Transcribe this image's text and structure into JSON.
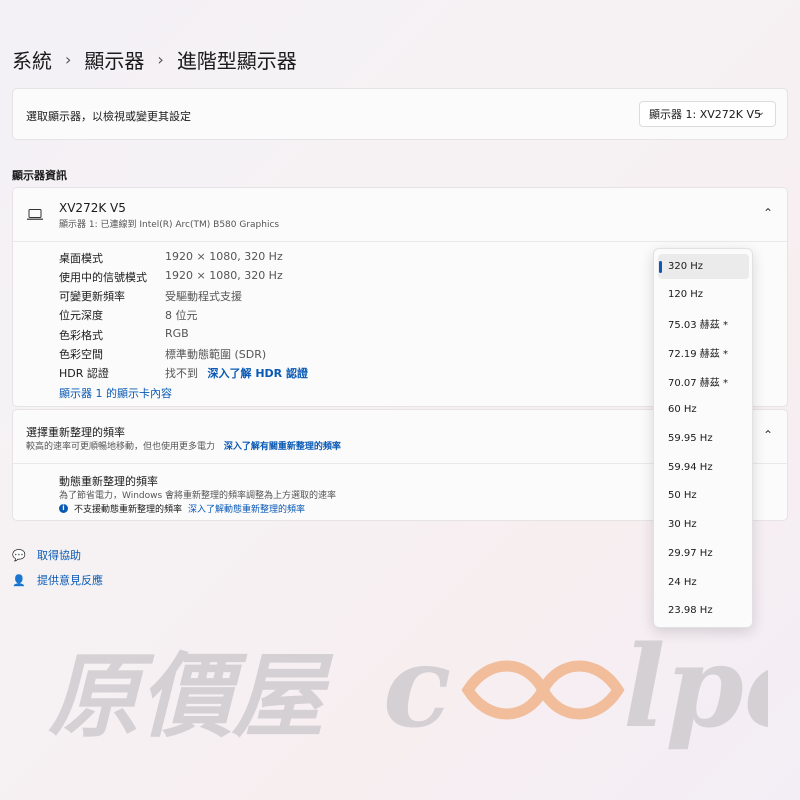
{
  "breadcrumb": {
    "item1": "系統",
    "item2": "顯示器",
    "current": "進階型顯示器",
    "sep": "›"
  },
  "selector": {
    "label": "選取顯示器，以檢視或變更其設定",
    "value": "顯示器 1: XV272K V5"
  },
  "section_title": "顯示器資訊",
  "monitor": {
    "name": "XV272K V5",
    "subtitle": "顯示器 1: 已連線到 Intel(R) Arc(TM) B580 Graphics",
    "rows": [
      {
        "key": "桌面模式",
        "value": "1920 × 1080, 320 Hz"
      },
      {
        "key": "使用中的信號模式",
        "value": "1920 × 1080, 320 Hz"
      },
      {
        "key": "可變更新頻率",
        "value": "受驅動程式支援"
      },
      {
        "key": "位元深度",
        "value": "8 位元"
      },
      {
        "key": "色彩格式",
        "value": "RGB"
      },
      {
        "key": "色彩空間",
        "value": "標準動態範圍 (SDR)"
      }
    ],
    "hdr_key": "HDR 認證",
    "hdr_value": "找不到",
    "hdr_link": "深入了解 HDR 認證",
    "adapter_link": "顯示器 1 的顯示卡內容"
  },
  "refresh": {
    "title": "選擇重新整理的頻率",
    "subtitle": "較高的速率可更順暢地移動，但也使用更多電力",
    "subtitle_link": "深入了解有關重新整理的頻率",
    "dynamic_title": "動態重新整理的頻率",
    "dynamic_sub": "為了節省電力，Windows 會將重新整理的頻率調整為上方選取的速率",
    "dynamic_info": "不支援動態重新整理的頻率",
    "dynamic_link": "深入了解動態重新整理的頻率"
  },
  "footer": {
    "help": "取得協助",
    "feedback": "提供意見反應"
  },
  "menu": {
    "selected_index": 0,
    "items": [
      "320 Hz",
      "120 Hz",
      "75.03 赫茲 *",
      "72.19 赫茲 *",
      "70.07 赫茲 *",
      "60 Hz",
      "59.95 Hz",
      "59.94 Hz",
      "50 Hz",
      "30 Hz",
      "29.97 Hz",
      "24 Hz",
      "23.98 Hz"
    ]
  },
  "watermark": {
    "cjk": "原價屋",
    "latin": "coolpc"
  },
  "colors": {
    "accent": "#0a5ab5",
    "watermark_grey": "#c9c6c9",
    "watermark_orange": "#f0b48c"
  }
}
